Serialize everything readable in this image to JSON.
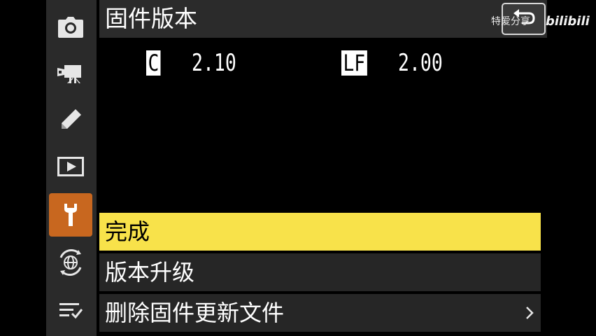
{
  "header": {
    "title": "固件版本",
    "back_icon": "return-icon"
  },
  "watermark": {
    "text": "特爱分享",
    "logo": "bilibili"
  },
  "firmware": [
    {
      "badge": "C",
      "version": "2.10"
    },
    {
      "badge": "LF",
      "version": "2.00"
    }
  ],
  "sidebar": {
    "items": [
      {
        "icon": "camera-icon"
      },
      {
        "icon": "movie-camera-icon"
      },
      {
        "icon": "pencil-icon"
      },
      {
        "icon": "playback-icon"
      },
      {
        "icon": "wrench-icon",
        "active": true
      },
      {
        "icon": "network-icon"
      },
      {
        "icon": "my-menu-icon"
      }
    ]
  },
  "menu": {
    "items": [
      {
        "label": "完成",
        "selected": true
      },
      {
        "label": "版本升级",
        "selected": false
      },
      {
        "label": "删除固件更新文件",
        "selected": false,
        "has_submenu": true
      }
    ]
  },
  "colors": {
    "selected": "#f8e24a",
    "active_tab": "#c8671f",
    "sidebar": "#2a2a2a",
    "row": "#262626"
  }
}
